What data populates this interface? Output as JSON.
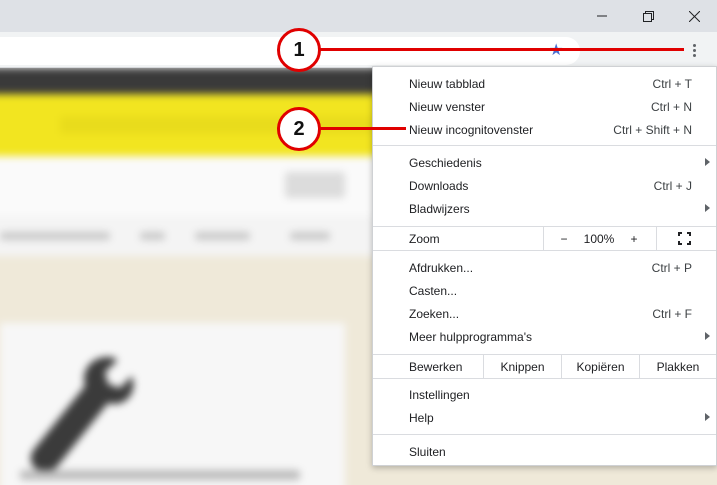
{
  "window": {
    "minimize_icon": "minimize-icon",
    "restore_icon": "restore-icon",
    "close_icon": "close-icon"
  },
  "toolbar": {
    "bookmark_icon": "star-icon",
    "menu_icon": "three-dots-icon"
  },
  "menu": {
    "items_top": [
      {
        "label": "Nieuw tabblad",
        "shortcut": "Ctrl + T"
      },
      {
        "label": "Nieuw venster",
        "shortcut": "Ctrl + N"
      },
      {
        "label": "Nieuw incognitovenster",
        "shortcut": "Ctrl + Shift + N"
      }
    ],
    "items_history": [
      {
        "label": "Geschiedenis",
        "shortcut": ""
      },
      {
        "label": "Downloads",
        "shortcut": "Ctrl + J"
      },
      {
        "label": "Bladwijzers",
        "shortcut": ""
      }
    ],
    "zoom": {
      "label": "Zoom",
      "minus": "−",
      "value": "100%",
      "plus": "+"
    },
    "items_tools": [
      {
        "label": "Afdrukken...",
        "shortcut": "Ctrl + P"
      },
      {
        "label": "Casten...",
        "shortcut": ""
      },
      {
        "label": "Zoeken...",
        "shortcut": "Ctrl + F"
      },
      {
        "label": "Meer hulpprogramma's",
        "shortcut": ""
      }
    ],
    "edit": {
      "label": "Bewerken",
      "cut": "Knippen",
      "copy": "Kopiëren",
      "paste": "Plakken"
    },
    "items_settings": [
      {
        "label": "Instellingen"
      },
      {
        "label": "Help"
      }
    ],
    "exit": {
      "label": "Sluiten"
    }
  },
  "callouts": {
    "first": "1",
    "second": "2"
  },
  "colors": {
    "callout_red": "#e00000",
    "page_yellow": "#f2e520"
  }
}
